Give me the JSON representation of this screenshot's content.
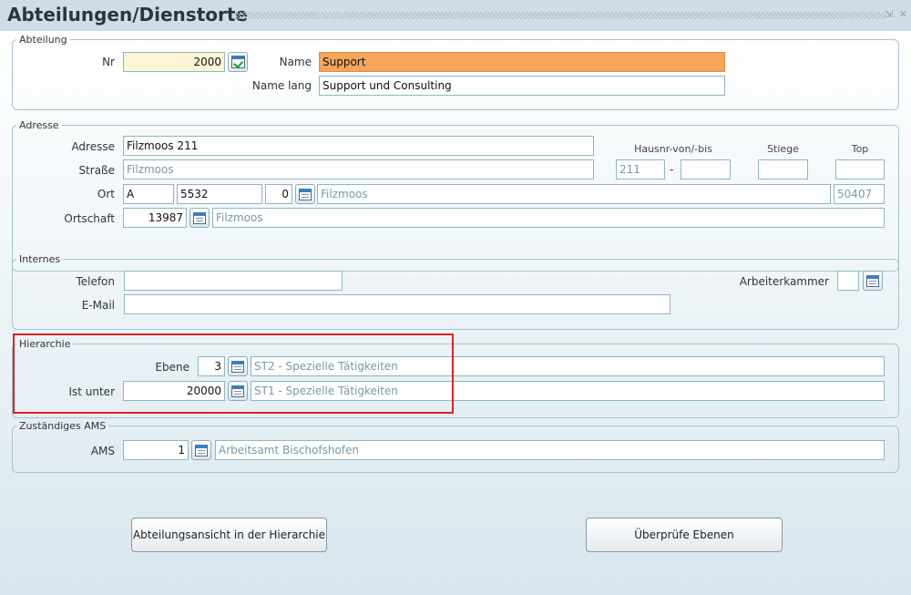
{
  "window": {
    "title": "Abteilungen/Dienstorte",
    "controls": [
      "⇲",
      "✕"
    ]
  },
  "abteilung": {
    "legend": "Abteilung",
    "nr_label": "Nr",
    "nr_value": "2000",
    "name_label": "Name",
    "name_value": "Support",
    "name_lang_label": "Name lang",
    "name_lang_value": "Support und Consulting"
  },
  "adresse": {
    "legend": "Adresse",
    "adresse_label": "Adresse",
    "adresse_value": "Filzmoos 211",
    "hausnr_header": "Hausnr-von/-bis",
    "stiege_header": "Stiege",
    "top_header": "Top",
    "strasse_label": "Straße",
    "strasse_value": "Filzmoos",
    "hausnr_von": "211",
    "hausnr_sep": "-",
    "hausnr_bis": "",
    "stiege_value": "",
    "top_value": "",
    "ort_label": "Ort",
    "land": "A",
    "plz": "5532",
    "ort_nr": "0",
    "ort_name": "Filzmoos",
    "gemeinde_nr": "50407",
    "ortschaft_label": "Ortschaft",
    "ortschaft_nr": "13987",
    "ortschaft_name": "Filzmoos"
  },
  "internes": {
    "legend": "Internes",
    "telefon_label": "Telefon",
    "telefon_value": "",
    "email_label": "E-Mail",
    "email_value": "",
    "ak_label": "Arbeiterkammer",
    "ak_value": ""
  },
  "hierarchie": {
    "legend": "Hierarchie",
    "ebene_label": "Ebene",
    "ebene_value": "3",
    "ebene_text": "ST2 - Spezielle Tätigkeiten",
    "ist_unter_label": "Ist unter",
    "ist_unter_value": "20000",
    "ist_unter_text": "ST1 - Spezielle Tätigkeiten"
  },
  "ams": {
    "legend": "Zuständiges AMS",
    "ams_label": "AMS",
    "ams_value": "1",
    "ams_text": "Arbeitsamt Bischofshofen"
  },
  "buttons": {
    "hierarchie_ansicht": "Abteilungsansicht in der Hierarchie",
    "pruefe_ebenen": "Überprüfe Ebenen"
  },
  "colors": {
    "highlight_name": "#f5a65b",
    "key_field": "#fff4d6",
    "annotation_box": "#e02020"
  }
}
